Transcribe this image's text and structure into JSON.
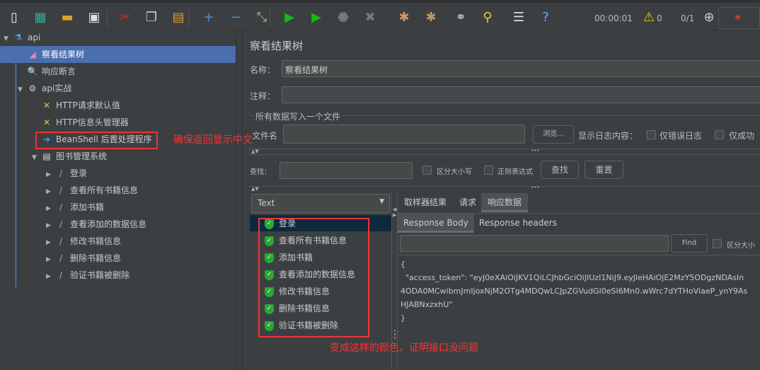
{
  "toolbar": {
    "icons": [
      "new-icon",
      "templates-icon",
      "open-icon",
      "save-icon",
      "cut-icon",
      "copy-icon",
      "paste-icon",
      "expand-icon",
      "collapse-icon",
      "toggle-icon",
      "start-icon",
      "start-no-pause-icon",
      "stop-icon",
      "shutdown-icon",
      "clear-icon",
      "clear-all-icon",
      "search-icon",
      "reset-search-icon",
      "function-helper-icon",
      "help-icon"
    ],
    "timer": "00:00:01",
    "warnings": "0",
    "threads": "0/1"
  },
  "tree": {
    "items": [
      {
        "label": "api",
        "icon": "test-plan-icon"
      },
      {
        "label": "察看结果树",
        "icon": "listener-icon",
        "selected": true
      },
      {
        "label": "响应断言",
        "icon": "assertion-icon"
      },
      {
        "label": "api实战",
        "icon": "thread-group-icon"
      },
      {
        "label": "HTTP请求默认值",
        "icon": "config-icon"
      },
      {
        "label": "HTTP信息头管理器",
        "icon": "config-icon"
      },
      {
        "label": "BeanShell 后置处理程序",
        "icon": "postprocessor-icon"
      },
      {
        "label": "图书管理系统",
        "icon": "controller-icon"
      },
      {
        "label": "登录",
        "icon": "sampler-icon"
      },
      {
        "label": "查看所有书籍信息",
        "icon": "sampler-icon"
      },
      {
        "label": "添加书籍",
        "icon": "sampler-icon"
      },
      {
        "label": "查看添加的数据信息",
        "icon": "sampler-icon"
      },
      {
        "label": "修改书籍信息",
        "icon": "sampler-icon"
      },
      {
        "label": "删除书籍信息",
        "icon": "sampler-icon"
      },
      {
        "label": "验证书籍被删除",
        "icon": "sampler-icon"
      }
    ]
  },
  "panel": {
    "title": "察看结果树",
    "name_label": "名称：",
    "name_value": "察看结果树",
    "comment_label": "注释：",
    "comment_value": "",
    "file_group": "所有数据写入一个文件",
    "filename_label": "文件名",
    "browse": "浏览...",
    "log_label": "显示日志内容：",
    "errors_only": "仅错误日志",
    "success_only": "仅成功",
    "search_label": "查找：",
    "case_sensitive": "区分大小写",
    "regex": "正则表达式",
    "find": "查找",
    "reset": "重置"
  },
  "results": {
    "renderer": "Text",
    "items": [
      "登录",
      "查看所有书籍信息",
      "添加书籍",
      "查看添加的数据信息",
      "修改书籍信息",
      "删除书籍信息",
      "验证书籍被删除"
    ],
    "status": "success",
    "tabs": [
      "取样器结果",
      "请求",
      "响应数据"
    ],
    "active_tab": "响应数据",
    "subtabs": [
      "Response Body",
      "Response headers"
    ],
    "active_subtab": "Response Body",
    "find_button": "Find",
    "case_label": "区分大小",
    "body_lines": [
      "{",
      "  \"access_token\": \"eyJ0eXAiOiJKV1QiLCJhbGciOiJIUzI1NiJ9.eyJleHAiOjE2MzY5ODgzNDAsIn",
      "4ODA0MCwibmJmIjoxNjM2OTg4MDQwLCJpZGVudGl0eSI6Mn0.wWrc7dYTHoViaeP_ynY9As",
      "HJABNxzxhU\"",
      "}"
    ]
  },
  "annotations": {
    "note1": "确保返回显示中文",
    "note2": "变成这样的颜色，证明接口没问题",
    "color": "#ff3030"
  }
}
